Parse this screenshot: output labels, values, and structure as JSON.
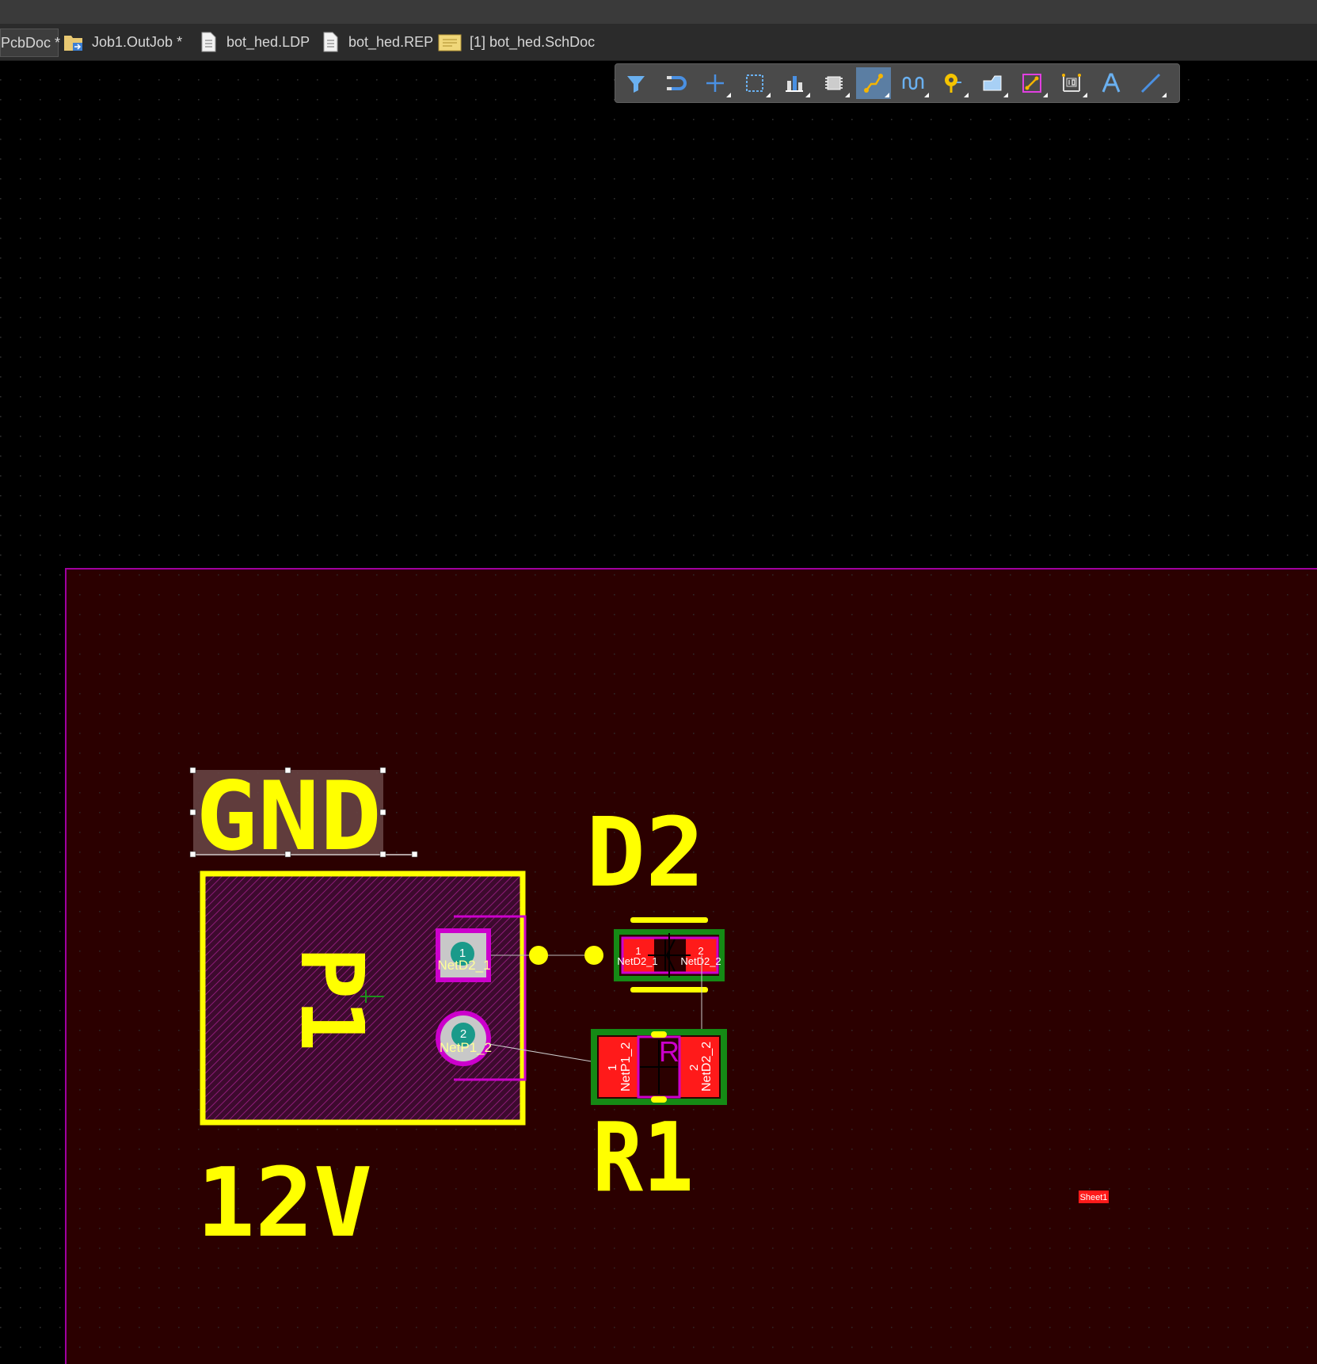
{
  "tabs": [
    {
      "label": "PcbDoc *",
      "icon": "pcb-doc-icon",
      "active": true
    },
    {
      "label": "Job1.OutJob *",
      "icon": "outjob-icon",
      "active": false
    },
    {
      "label": "bot_hed.LDP",
      "icon": "document-icon",
      "active": false
    },
    {
      "label": "bot_hed.REP",
      "icon": "document-icon",
      "active": false
    },
    {
      "label": "[1] bot_hed.SchDoc",
      "icon": "schematic-icon",
      "active": false
    }
  ],
  "toolbar": {
    "tools": [
      {
        "name": "filter-icon"
      },
      {
        "name": "snap-magnet-icon"
      },
      {
        "name": "move-cross-icon"
      },
      {
        "name": "select-rectangle-icon"
      },
      {
        "name": "align-icon"
      },
      {
        "name": "place-component-icon"
      },
      {
        "name": "interactive-route-icon",
        "selected": true
      },
      {
        "name": "length-tuning-icon"
      },
      {
        "name": "place-via-icon"
      },
      {
        "name": "polygon-pour-icon"
      },
      {
        "name": "place-track-icon"
      },
      {
        "name": "place-dimension-icon"
      },
      {
        "name": "place-string-icon"
      },
      {
        "name": "place-line-icon"
      }
    ]
  },
  "board": {
    "labels": {
      "gnd": "GND",
      "d2": "D2",
      "r1": "R1",
      "p1": "P1",
      "v12": "12V",
      "sheet": "Sheet1"
    },
    "pads": {
      "p1_pin1": "1",
      "p1_pin1_net": "NetD2_1",
      "p1_pin2": "2",
      "p1_pin2_net": "NetP1_2",
      "d2_pin1": "1",
      "d2_pin1_net": "NetD2_1",
      "d2_pin2": "2",
      "d2_pin2_net": "NetD2_2",
      "r1_pin1": "1",
      "r1_pin1_net": "NetP1_2",
      "r1_pin2": "2",
      "r1_pin2_net": "NetD2_2",
      "r1_mark": "R"
    }
  },
  "colors": {
    "board_fill": "#2b0000",
    "board_outline": "#a000a0",
    "silkscreen": "#ffff00",
    "pad_red": "#ff1a1a",
    "pad_green": "#158a15",
    "courtyard": "#cc00cc",
    "grid_dot": "#2a2a2a"
  }
}
